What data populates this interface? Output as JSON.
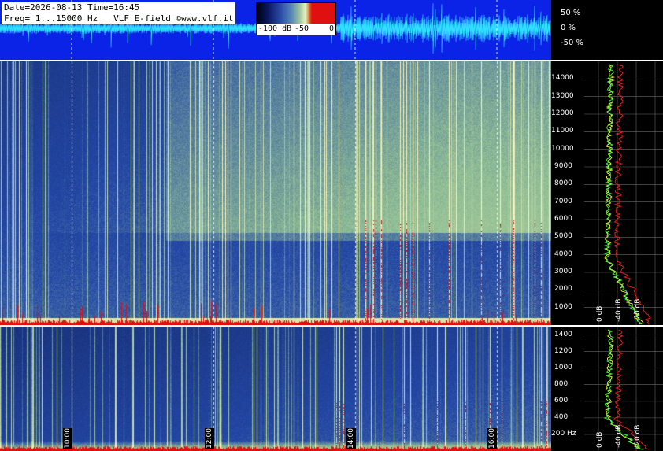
{
  "info": {
    "line1": "Date=2026-08-13 Time=16:45",
    "line2": "Freq= 1...15000 Hz   VLF E-field ©www.vlf.it"
  },
  "colorbar": {
    "labels": [
      "-100 dB",
      "-50",
      "0"
    ]
  },
  "wave_scale": [
    "50 %",
    "0 %",
    "-50 %"
  ],
  "chart_data": [
    {
      "type": "heatmap",
      "title": "",
      "xlabel": "",
      "ylabel": "",
      "x_ticks": [
        "10:00",
        "12:00",
        "14:00",
        "16:00"
      ],
      "y_ticks_top_hz": [
        "1000",
        "2000",
        "3000",
        "4000",
        "5000",
        "6000",
        "7000",
        "8000",
        "9000",
        "10000",
        "11000",
        "12000",
        "13000",
        "14000"
      ],
      "ylim_top_hz": [
        0,
        15000
      ],
      "y_ticks_bottom_hz": [
        "200 Hz",
        "400",
        "600",
        "800",
        "1000",
        "1200",
        "1400"
      ],
      "ylim_bottom_hz": [
        0,
        1500
      ],
      "colorbar_db": [
        -100,
        0
      ],
      "time_range": [
        "09:00",
        "16:45"
      ]
    },
    {
      "type": "line",
      "title": "",
      "x_ticks_db": [
        "0 dB",
        "-40 dB",
        "-20 dB"
      ],
      "series_colors": [
        "#ffff40",
        "#ff2020",
        "#40ff40"
      ]
    }
  ],
  "profile_ticks_top": [
    "0 dB",
    "-40 dB",
    "-20 dB"
  ],
  "profile_ticks_bot": [
    "0 dB",
    "-40 dB",
    "-20 dB"
  ],
  "colors": {
    "wave_bg": "#0a23e6",
    "wave_line": "#30e0ff",
    "spectrum_low": "#14254f",
    "spectrum_high": "#e8f0c0",
    "signal_red": "#e01010"
  }
}
